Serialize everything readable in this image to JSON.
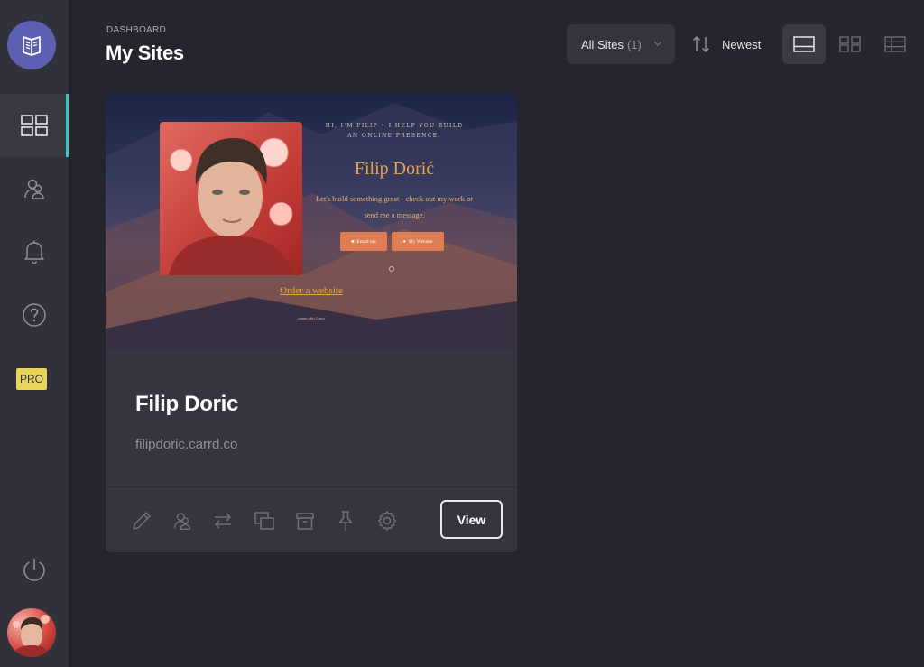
{
  "sidebar": {
    "logo_icon": "carrd-logo-icon",
    "items": [
      {
        "name": "sites",
        "icon": "grid-icon",
        "active": true
      },
      {
        "name": "account",
        "icon": "users-icon",
        "active": false
      },
      {
        "name": "notifications",
        "icon": "bell-icon",
        "active": false
      },
      {
        "name": "help",
        "icon": "help-circle-icon",
        "active": false
      }
    ],
    "pro_label": "PRO",
    "logout_icon": "power-icon"
  },
  "header": {
    "breadcrumb": "DASHBOARD",
    "title": "My Sites",
    "filter_label": "All Sites",
    "filter_count": "(1)",
    "sort_label": "Newest"
  },
  "view_modes": [
    {
      "name": "large-cards",
      "icon": "layout-large-icon",
      "active": true
    },
    {
      "name": "small-cards",
      "icon": "layout-grid-icon",
      "active": false
    },
    {
      "name": "list",
      "icon": "layout-list-icon",
      "active": false
    }
  ],
  "sites": [
    {
      "name": "Filip Doric",
      "url": "filipdoric.carrd.co",
      "view_label": "View",
      "preview": {
        "tagline": "HI, I'M FILIP • I HELP YOU BUILD AN ONLINE PRESENCE.",
        "heading": "Filip Dorić",
        "description": "Let's build something great - check out my work or send me a message.",
        "button_1": "Email me",
        "button_2": "My Website",
        "link": "Order a website",
        "footer": "made with Carrd"
      },
      "actions": [
        {
          "name": "edit",
          "icon": "pencil-icon"
        },
        {
          "name": "access",
          "icon": "users-icon"
        },
        {
          "name": "transfer",
          "icon": "transfer-icon"
        },
        {
          "name": "duplicate",
          "icon": "copy-icon"
        },
        {
          "name": "archive",
          "icon": "archive-icon"
        },
        {
          "name": "pin",
          "icon": "pin-icon"
        },
        {
          "name": "settings",
          "icon": "gear-icon"
        }
      ]
    }
  ],
  "colors": {
    "background": "#25262d",
    "sidebar": "#30313a",
    "accent": "#39c6c0",
    "pro": "#e8d35b",
    "card": "#34353f"
  }
}
